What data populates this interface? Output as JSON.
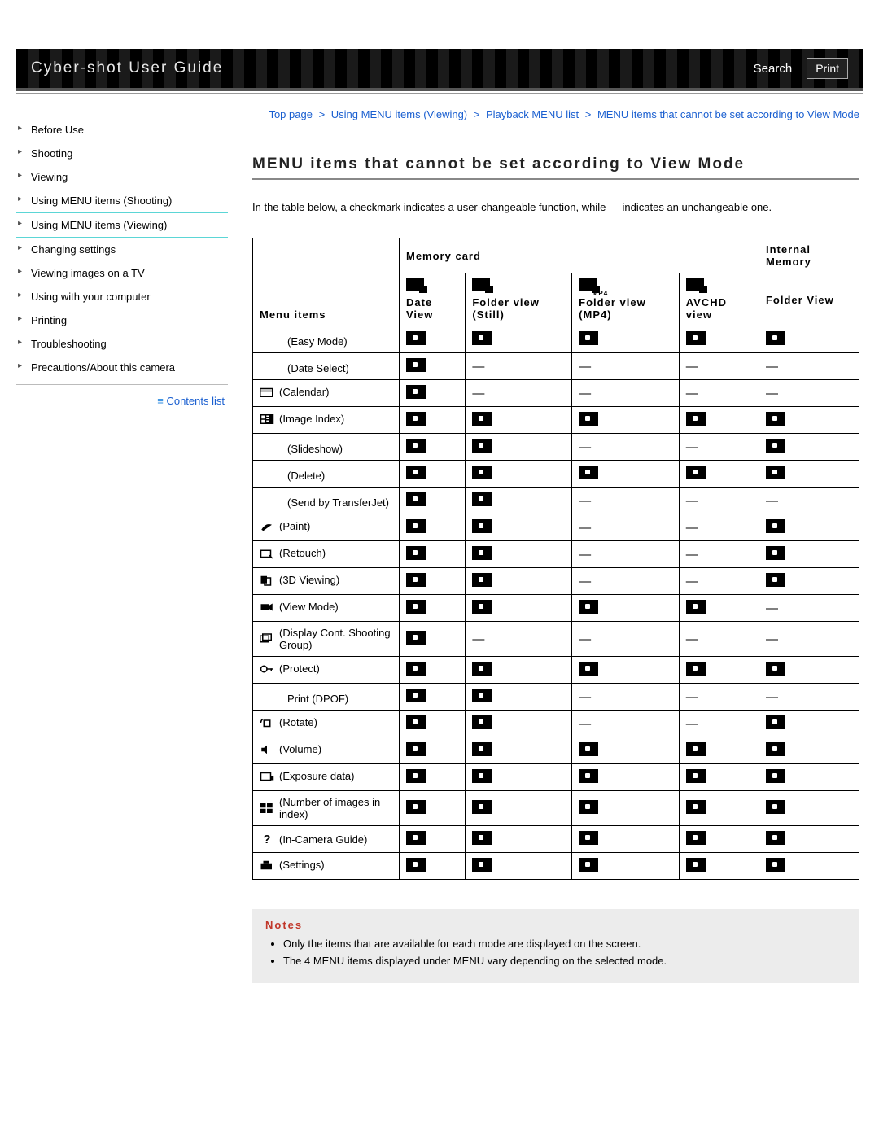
{
  "header": {
    "title": "Cyber-shot User Guide",
    "search": "Search",
    "print": "Print"
  },
  "breadcrumb": {
    "items": [
      "Top page",
      "Using MENU items (Viewing)",
      "Playback MENU list",
      "MENU items that cannot be set according to View Mode"
    ],
    "sep": ">"
  },
  "sidebar": {
    "items": [
      "Before Use",
      "Shooting",
      "Viewing",
      "Using MENU items (Shooting)",
      "Using MENU items (Viewing)",
      "Changing settings",
      "Viewing images on a TV",
      "Using with your computer",
      "Printing",
      "Troubleshooting",
      "Precautions/About this camera"
    ],
    "contents_link": "Contents list"
  },
  "page": {
    "title": "MENU items that cannot be set according to View Mode",
    "intro": "In the table below, a checkmark indicates a user-changeable function, while — indicates an unchangeable one."
  },
  "table": {
    "header": {
      "menu_items": "Menu items",
      "memory_card": "Memory card",
      "internal_memory": "Internal Memory",
      "cols": [
        {
          "label": "Date View",
          "icon_sub": ""
        },
        {
          "label": "Folder view (Still)",
          "icon_sub": ""
        },
        {
          "label": "Folder view (MP4)",
          "icon_sub": "MP4"
        },
        {
          "label": "AVCHD view",
          "icon_sub": ""
        },
        {
          "label": "Folder View",
          "no_icon": true
        }
      ]
    },
    "rows": [
      {
        "icon": "",
        "label": "(Easy Mode)",
        "v": [
          "c",
          "c",
          "c",
          "c",
          "c"
        ]
      },
      {
        "icon": "",
        "label": "(Date Select)",
        "v": [
          "c",
          "d",
          "d",
          "d",
          "d"
        ]
      },
      {
        "icon": "calendar",
        "label": "(Calendar)",
        "v": [
          "c",
          "d",
          "d",
          "d",
          "d"
        ]
      },
      {
        "icon": "index",
        "label": "(Image Index)",
        "v": [
          "c",
          "c",
          "c",
          "c",
          "c"
        ]
      },
      {
        "icon": "",
        "label": "(Slideshow)",
        "v": [
          "c",
          "c",
          "d",
          "d",
          "c"
        ]
      },
      {
        "icon": "",
        "label": "(Delete)",
        "v": [
          "c",
          "c",
          "c",
          "c",
          "c"
        ]
      },
      {
        "icon": "",
        "label": "(Send by TransferJet)",
        "v": [
          "c",
          "c",
          "d",
          "d",
          "d"
        ]
      },
      {
        "icon": "paint",
        "label": "(Paint)",
        "v": [
          "c",
          "c",
          "d",
          "d",
          "c"
        ]
      },
      {
        "icon": "retouch",
        "label": "(Retouch)",
        "v": [
          "c",
          "c",
          "d",
          "d",
          "c"
        ]
      },
      {
        "icon": "3d",
        "label": "(3D Viewing)",
        "v": [
          "c",
          "c",
          "d",
          "d",
          "c"
        ]
      },
      {
        "icon": "viewmode",
        "label": "(View Mode)",
        "v": [
          "c",
          "c",
          "c",
          "c",
          "d"
        ]
      },
      {
        "icon": "group",
        "label": "(Display Cont. Shooting Group)",
        "v": [
          "c",
          "d",
          "d",
          "d",
          "d"
        ]
      },
      {
        "icon": "protect",
        "label": "(Protect)",
        "v": [
          "c",
          "c",
          "c",
          "c",
          "c"
        ]
      },
      {
        "icon": "",
        "label": "Print (DPOF)",
        "v": [
          "c",
          "c",
          "d",
          "d",
          "d"
        ]
      },
      {
        "icon": "rotate",
        "label": "(Rotate)",
        "v": [
          "c",
          "c",
          "d",
          "d",
          "c"
        ]
      },
      {
        "icon": "volume",
        "label": "(Volume)",
        "v": [
          "c",
          "c",
          "c",
          "c",
          "c"
        ]
      },
      {
        "icon": "exposure",
        "label": "(Exposure data)",
        "v": [
          "c",
          "c",
          "c",
          "c",
          "c"
        ]
      },
      {
        "icon": "number",
        "label": "(Number of images in index)",
        "v": [
          "c",
          "c",
          "c",
          "c",
          "c"
        ]
      },
      {
        "icon": "help",
        "label": "(In-Camera Guide)",
        "v": [
          "c",
          "c",
          "c",
          "c",
          "c"
        ]
      },
      {
        "icon": "settings",
        "label": "(Settings)",
        "v": [
          "c",
          "c",
          "c",
          "c",
          "c"
        ]
      }
    ]
  },
  "notes": {
    "title": "Notes",
    "items": [
      "Only the items that are available for each mode are displayed on the screen.",
      "The 4 MENU items displayed under MENU vary depending on the selected mode."
    ]
  }
}
